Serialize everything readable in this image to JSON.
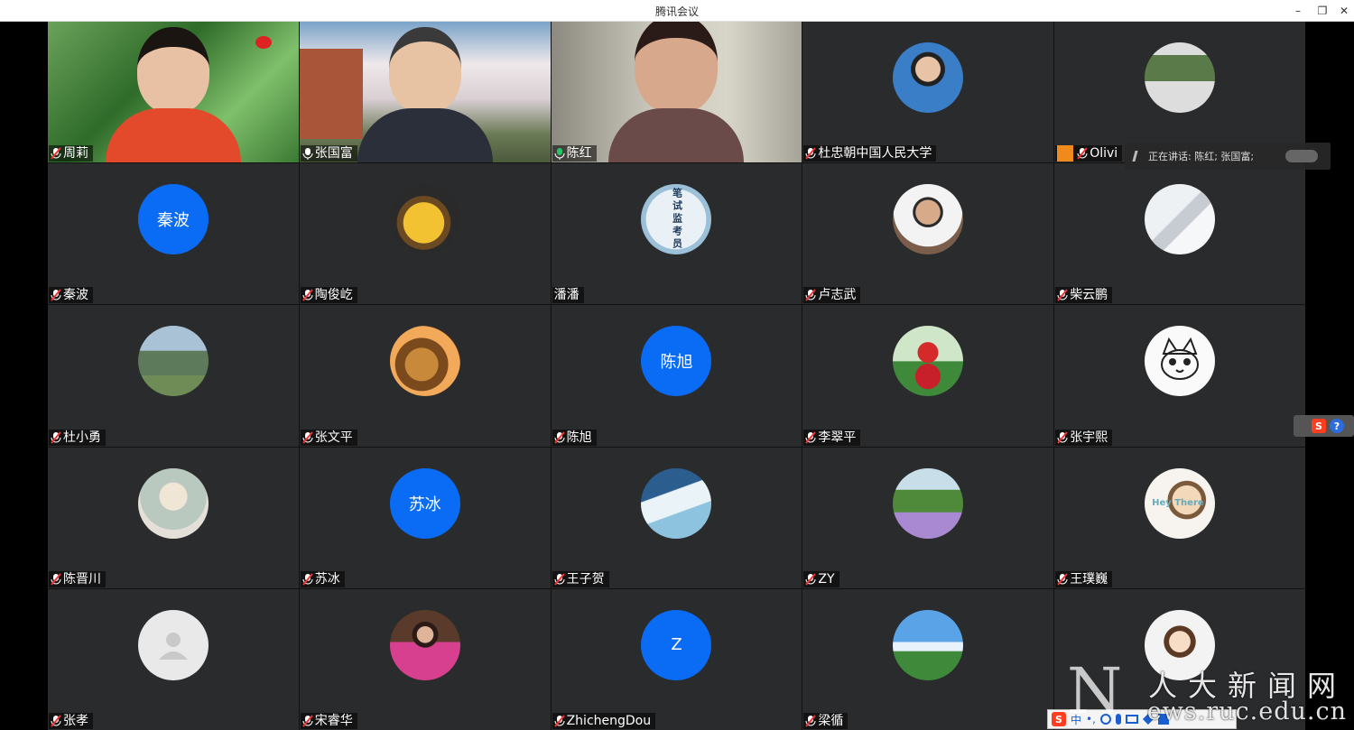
{
  "window": {
    "title": "腾讯会议",
    "minimize": "–",
    "restore": "❐",
    "close": "✕"
  },
  "speaking": {
    "text": "正在讲话: 陈红; 张国富;"
  },
  "participants": [
    {
      "name": "周莉",
      "kind": "video"
    },
    {
      "name": "张国富",
      "kind": "video"
    },
    {
      "name": "陈红",
      "kind": "video",
      "active": true
    },
    {
      "name": "杜忠朝中国人民大学",
      "kind": "photo",
      "icon": "portrait-avatar"
    },
    {
      "name": "Olivi",
      "kind": "photo",
      "icon": "gallery-photo-avatar"
    },
    {
      "name": "秦波",
      "kind": "text",
      "avatar_text": "秦波"
    },
    {
      "name": "陶俊屹",
      "kind": "photo",
      "icon": "pikachu-avatar"
    },
    {
      "name": "潘潘",
      "kind": "photo",
      "icon": "exam-proctor-avatar",
      "avatar_text": "笔试监考员"
    },
    {
      "name": "卢志武",
      "kind": "photo",
      "icon": "portrait-avatar"
    },
    {
      "name": "柴云鹏",
      "kind": "photo",
      "icon": "dance-photo-avatar"
    },
    {
      "name": "杜小勇",
      "kind": "photo",
      "icon": "campus-photo-avatar"
    },
    {
      "name": "张文平",
      "kind": "photo",
      "icon": "lion-avatar"
    },
    {
      "name": "陈旭",
      "kind": "text",
      "avatar_text": "陈旭"
    },
    {
      "name": "李翠平",
      "kind": "photo",
      "icon": "christmas-tomato-avatar"
    },
    {
      "name": "张宇熙",
      "kind": "photo",
      "icon": "cartoon-cat-avatar"
    },
    {
      "name": "陈晋川",
      "kind": "photo",
      "icon": "sketch-portrait-avatar"
    },
    {
      "name": "苏冰",
      "kind": "text",
      "avatar_text": "苏冰"
    },
    {
      "name": "王子贺",
      "kind": "photo",
      "icon": "snowboard-avatar"
    },
    {
      "name": "ZY",
      "kind": "photo",
      "icon": "lavender-field-avatar"
    },
    {
      "name": "王璞巍",
      "kind": "photo",
      "icon": "hey-there-cartoon-avatar",
      "avatar_text": "Hey There"
    },
    {
      "name": "张孝",
      "kind": "placeholder",
      "icon": "default-user-avatar"
    },
    {
      "name": "宋睿华",
      "kind": "photo",
      "icon": "woman-photo-avatar"
    },
    {
      "name": "ZhichengDou",
      "kind": "text",
      "avatar_text": "Z"
    },
    {
      "name": "梁循",
      "kind": "photo",
      "icon": "sky-tree-avatar"
    },
    {
      "name": "",
      "kind": "photo",
      "icon": "cartoon-girl-avatar"
    }
  ],
  "ime": {
    "logo": "S",
    "mode": "中",
    "punct": "•,",
    "help": "?"
  },
  "watermark": {
    "cn": "人大新闻网",
    "en": "ews.ruc.edu.cn",
    "n": "N"
  },
  "colors": {
    "tile_bg": "#2a2b2d",
    "avatar_blue": "#0a6cf5",
    "active_border": "#29c466"
  }
}
